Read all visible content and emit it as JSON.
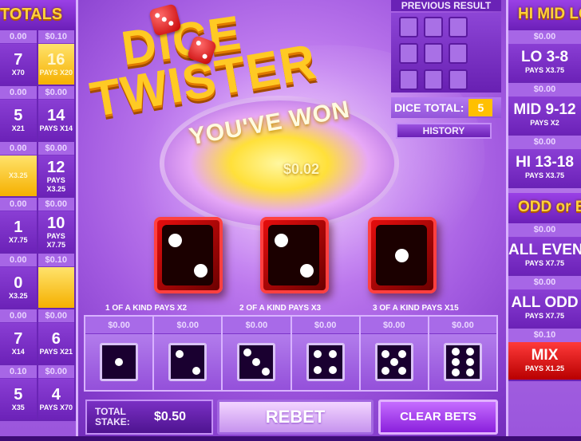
{
  "left_panel": {
    "title": "TOTALS",
    "rows": [
      [
        {
          "amount": "0.00",
          "number": "7",
          "pays": "X70",
          "gold": false
        },
        {
          "amount": "$0.10",
          "number": "16",
          "pays": "PAYS X20",
          "gold": true
        }
      ],
      [
        {
          "amount": "0.00",
          "number": "5",
          "pays": "X21",
          "gold": false
        },
        {
          "amount": "$0.00",
          "number": "14",
          "pays": "PAYS X14",
          "gold": false
        }
      ],
      [
        {
          "amount": "0.00",
          "number": "",
          "pays": "X3.25",
          "gold": true
        },
        {
          "amount": "$0.00",
          "number": "12",
          "pays": "PAYS X3.25",
          "gold": false
        }
      ],
      [
        {
          "amount": "0.00",
          "number": "1",
          "pays": "X7.75",
          "gold": false
        },
        {
          "amount": "$0.00",
          "number": "10",
          "pays": "PAYS X7.75",
          "gold": false
        }
      ],
      [
        {
          "amount": "0.00",
          "number": "0",
          "pays": "X3.25",
          "gold": false
        },
        {
          "amount": "$0.10",
          "number": "",
          "pays": "",
          "gold": true
        }
      ],
      [
        {
          "amount": "0.00",
          "number": "7",
          "pays": "X14",
          "gold": false
        },
        {
          "amount": "$0.00",
          "number": "6",
          "pays": "PAYS X21",
          "gold": false
        }
      ],
      [
        {
          "amount": "0.10",
          "number": "5",
          "pays": "X35",
          "gold": false
        },
        {
          "amount": "$0.00",
          "number": "4",
          "pays": "PAYS X70",
          "gold": false
        }
      ]
    ]
  },
  "logo": {
    "line1": "DICE",
    "line2": "TWISTER"
  },
  "win": {
    "message": "YOU'VE WON",
    "amount": "$0.02"
  },
  "previous_result": {
    "title": "PREVIOUS RESULT",
    "dice_total_label": "DICE TOTAL:",
    "dice_total_value": "5",
    "history_label": "HISTORY"
  },
  "right_panel": {
    "title_top": "HI MID LO",
    "top_bets": [
      {
        "amount": "$0.00",
        "name": "LO 3-8",
        "pays": "PAYS X3.75",
        "red": false
      },
      {
        "amount": "$0.00",
        "name": "MID 9-12",
        "pays": "PAYS X2",
        "red": false
      },
      {
        "amount": "$0.00",
        "name": "HI 13-18",
        "pays": "PAYS X3.75",
        "red": false
      }
    ],
    "title_bottom": "ODD or EVEN",
    "bottom_bets": [
      {
        "amount": "$0.00",
        "name": "ALL EVEN",
        "pays": "PAYS X7.75",
        "red": false
      },
      {
        "amount": "$0.00",
        "name": "ALL ODD",
        "pays": "PAYS X7.75",
        "red": false
      },
      {
        "amount": "$0.10",
        "name": "MIX",
        "pays": "PAYS X1.25",
        "red": true
      }
    ]
  },
  "result_dice": [
    2,
    2,
    1
  ],
  "kind_labels": [
    "1 OF A KIND PAYS X2",
    "2 OF A KIND PAYS X3",
    "3 OF A KIND PAYS X15"
  ],
  "board": [
    {
      "amount": "$0.00",
      "face": 1
    },
    {
      "amount": "$0.00",
      "face": 2
    },
    {
      "amount": "$0.00",
      "face": 3
    },
    {
      "amount": "$0.00",
      "face": 4
    },
    {
      "amount": "$0.00",
      "face": 5
    },
    {
      "amount": "$0.00",
      "face": 6
    }
  ],
  "bottom_bar": {
    "stake_label": "TOTAL STAKE:",
    "stake_value": "$0.50",
    "rebet_label": "REBET",
    "clear_label": "CLEAR BETS"
  },
  "colors": {
    "accent_gold": "#ffca24",
    "panel_purple": "#6c22b8",
    "die_red": "#e50d0d"
  }
}
